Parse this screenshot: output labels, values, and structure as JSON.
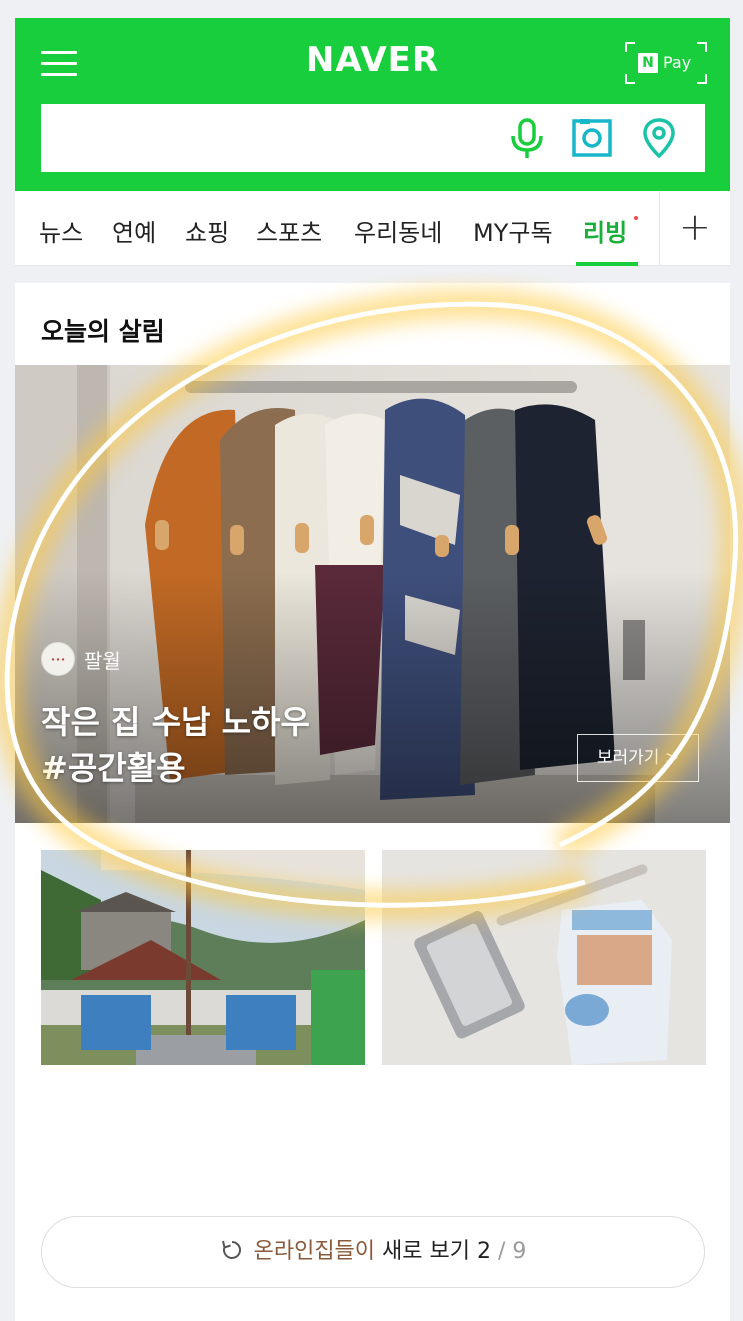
{
  "header": {
    "logo": "NAVER",
    "pay_n": "N",
    "pay_label": "Pay",
    "search_placeholder": ""
  },
  "nav": {
    "items": [
      "뉴스",
      "연예",
      "쇼핑",
      "스포츠",
      "우리동네",
      "MY구독",
      "리빙"
    ],
    "active": "리빙"
  },
  "section": {
    "title": "오늘의 살림"
  },
  "hero": {
    "author": "팔월",
    "title_line1": "작은 집 수납 노하우",
    "title_line2": "#공간활용",
    "button": "보러가기 >"
  },
  "more": {
    "highlight": "온라인집들이",
    "text": " 새로 보기 ",
    "page": "2",
    "separator": " / ",
    "total": "9"
  },
  "colors": {
    "brand_green": "#19ce3c",
    "active_tab": "#19b03a",
    "annotation_circle": "#ffd35a"
  },
  "icons": [
    "menu-icon",
    "mic-icon",
    "lens-icon",
    "place-icon",
    "plus-icon",
    "refresh-icon"
  ]
}
